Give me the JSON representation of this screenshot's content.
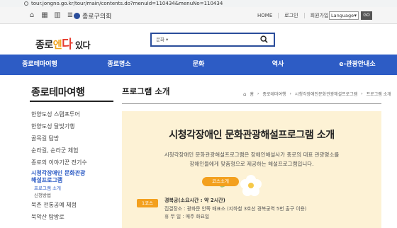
{
  "browser": {
    "url": "tour.jongno.go.kr/tour/main/contents.do?menuId=110434&menuNo=110434"
  },
  "topbar": {
    "org_name": "종로구의회",
    "links": [
      "HOME",
      "로그인",
      "회원가입"
    ],
    "language_select": "Language",
    "go_button": "GO"
  },
  "header": {
    "logo": {
      "part1": "종로",
      "part2": "엔",
      "part3": "다",
      "part4": " 있다"
    },
    "search": {
      "category": "문화",
      "value": ""
    }
  },
  "nav": {
    "items": [
      "종로테마여행",
      "종로명소",
      "문화",
      "역사",
      "e-관광안내소"
    ]
  },
  "sidebar": {
    "title": "종로테마여행",
    "items": [
      "한양도성 스탬프투어",
      "한양도성 달빛기행",
      "골목길 탐방",
      "순라길, 순라군 체험",
      "종로의 이야기꾼 전기수"
    ],
    "active_item_line1": "시청각장애인 문화관광",
    "active_item_line2": "해설프로그램",
    "sub_items": [
      "프로그램 소개",
      "신청방법"
    ],
    "items_after": [
      "북촌 전통공예 체험",
      "북악산 탐방로"
    ]
  },
  "content": {
    "title": "프로그램 소개",
    "breadcrumb": [
      "홈",
      "종로테마여행",
      "시청각장애인문화관광해설프로그램",
      "프로그램 소개"
    ],
    "panel_title": "시청각장애인 문화관광해설프로그램 소개",
    "panel_desc_line1": "시청각장애인 문화관광해설프로그램은 장애인해설사가 종로의 대표 관광명소를",
    "panel_desc_line2": "장애인들에게 맞춤형으로 제공하는 해설프로그램입니다.",
    "course_badge": "코스소개",
    "course_number": "1코스",
    "course_name": "경복궁(소요시간 : 약 2시간)",
    "course_meeting": "집결장소 : 광화문 안쪽 매표소 (지하철 3호선 경복궁역 5번 출구 이용)",
    "course_closed": "휴 무 일 : 매주 화요일"
  },
  "colors": {
    "nav_bg": "#2d5cc5",
    "accent_orange": "#f3a01e",
    "panel_bg": "#fdf2d5"
  }
}
